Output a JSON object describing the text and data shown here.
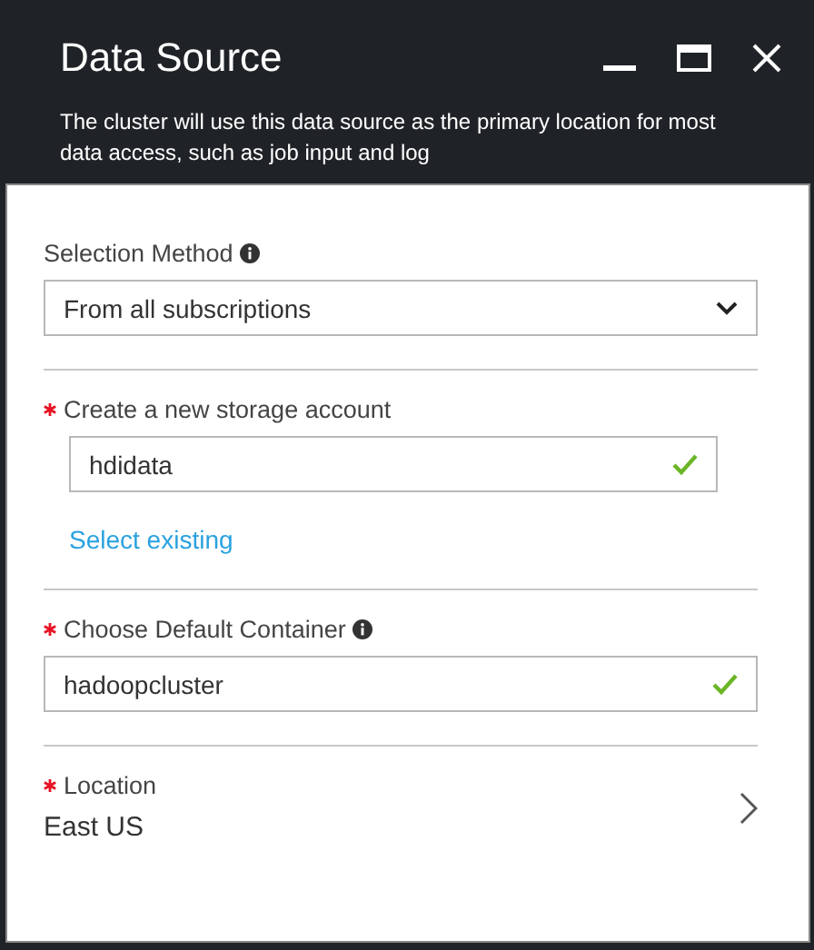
{
  "window": {
    "title": "Data Source",
    "description": "The cluster will use this data source as the primary location for most data access, such as job input and log"
  },
  "sections": [
    {
      "kind": "dropdown",
      "label": "Selection Method",
      "required": false,
      "info": true,
      "value": "From all subscriptions"
    },
    {
      "kind": "text",
      "label": "Create a new storage account",
      "required": true,
      "info": false,
      "value": "hdidata",
      "valid": true,
      "link": "Select existing"
    },
    {
      "kind": "text",
      "label": "Choose Default Container",
      "required": true,
      "info": true,
      "value": "hadoopcluster",
      "valid": true
    },
    {
      "kind": "picker",
      "label": "Location",
      "required": true,
      "info": false,
      "value": "East US"
    }
  ]
}
